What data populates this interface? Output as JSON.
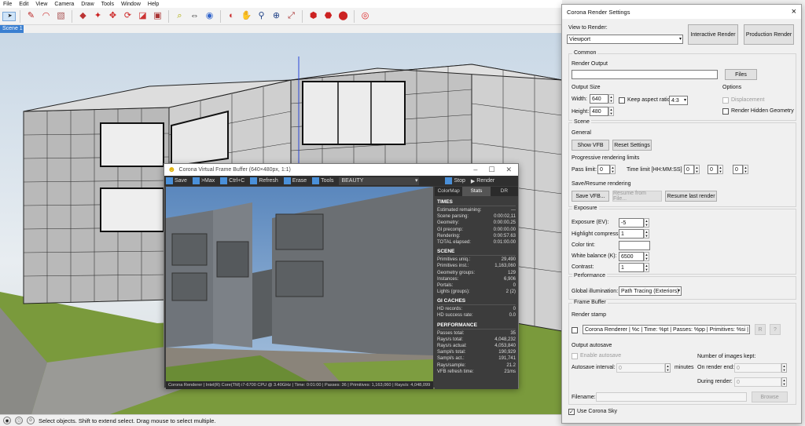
{
  "menu": [
    "File",
    "Edit",
    "View",
    "Camera",
    "Draw",
    "Tools",
    "Window",
    "Help"
  ],
  "scene_tab": "Scene 1",
  "status_text": "Select objects. Shift to extend select. Drag mouse to select multiple.",
  "vfb": {
    "title": "Corona Virtual Frame Buffer (640×480px, 1:1)",
    "toolbar": {
      "save": "Save",
      "max": ">Max",
      "ctrlc": "Ctrl+C",
      "refresh": "Refresh",
      "erase": "Erase",
      "tools": "Tools",
      "pass": "BEAUTY",
      "stop": "Stop",
      "render": "Render"
    },
    "tabs": [
      "ColorMap",
      "Stats",
      "DR"
    ],
    "times": {
      "heading": "TIMES",
      "rows": [
        [
          "Estimated remaining:",
          "---"
        ],
        [
          "Scene parsing:",
          "0:00:02,11"
        ],
        [
          "Geometry:",
          "0:00:00.25"
        ],
        [
          "GI precomp:",
          "0:00:00.00"
        ],
        [
          "Rendering:",
          "0:00:57.63"
        ],
        [
          "TOTAL elapsed:",
          "0:01:00.00"
        ]
      ]
    },
    "scene": {
      "heading": "SCENE",
      "rows": [
        [
          "Primitives uniq.:",
          "29,490"
        ],
        [
          "Primitives inst.:",
          "1,163,060"
        ],
        [
          "Geometry groups:",
          "129"
        ],
        [
          "Instances:",
          "6,906"
        ],
        [
          "Portals:",
          "0"
        ],
        [
          "Lights (groups):",
          "2 (2)"
        ]
      ]
    },
    "gi": {
      "heading": "GI CACHES",
      "rows": [
        [
          "HD records:",
          "0"
        ],
        [
          "HD success rate:",
          "0.0"
        ]
      ]
    },
    "perf": {
      "heading": "PERFORMANCE",
      "rows": [
        [
          "Passes total:",
          "35"
        ],
        [
          "Rays/s total:",
          "4,048,232"
        ],
        [
          "Rays/s actual:",
          "4,053,840"
        ],
        [
          "Sampl/s total:",
          "190,929"
        ],
        [
          "Sampl/s act.:",
          "191,741"
        ],
        [
          "Rays/sample:",
          "21.2"
        ],
        [
          "VFB refresh time:",
          "21ms"
        ]
      ]
    },
    "status": "Corona Renderer | Intel(R) Core(TM) i7-6700 CPU @ 3.40GHz | Time: 0:01:00 | Passes: 36 | Primitives: 1,163,060 | Rays/s: 4,048,099"
  },
  "crs": {
    "title": "Corona Render Settings",
    "close": "×",
    "view_to_render_label": "View to Render:",
    "view_to_render_value": "Viewport",
    "interactive_btn": "Interactive Render",
    "production_btn": "Production Render",
    "common": "Common",
    "render_output": "Render Output",
    "files_btn": "Files",
    "output_size": "Output Size",
    "options": "Options",
    "width_label": "Width:",
    "width_value": "640",
    "height_label": "Height:",
    "height_value": "480",
    "keep_aspect": "Keep aspect ratio",
    "aspect_value": "4:3",
    "displacement": "Displacement",
    "render_hidden": "Render Hidden Geometry",
    "scene": "Scene",
    "general": "General",
    "show_vfb": "Show VFB",
    "reset_settings": "Reset Settings",
    "prog_limits": "Progressive rendering limits",
    "pass_limit_label": "Pass limit:",
    "pass_limit_value": "0",
    "time_limit_label": "Time limit [HH:MM:SS]",
    "time_h": "0",
    "time_m": "0",
    "time_s": "0",
    "save_resume": "Save/Resume rendering",
    "save_vfb": "Save VFB...",
    "resume_file": "Resume from File...",
    "resume_last": "Resume last render",
    "exposure": "Exposure",
    "exposure_ev_label": "Exposure (EV):",
    "exposure_ev": "-5",
    "highlight_label": "Highlight compress:",
    "highlight": "1",
    "color_tint_label": "Color tint:",
    "white_balance_label": "White balance (K):",
    "white_balance": "6500",
    "contrast_label": "Contrast:",
    "contrast": "1",
    "performance": "Performance",
    "gi_label": "Global illumination:",
    "gi_value": "Path Tracing (Exteriors)",
    "frame_buffer": "Frame Buffer",
    "render_stamp": "Render stamp",
    "stamp_text": "Corona Renderer | %c | Time: %pt | Passes: %pp | Primitives: %si | Rays/s: %",
    "stamp_r": "R",
    "stamp_q": "?",
    "output_autosave": "Output autosave",
    "enable_autosave": "Enable autosave",
    "autosave_interval": "Autosave interval:",
    "autosave_value": "0",
    "minutes": "minutes",
    "num_images": "Number of images kept:",
    "on_render_end": "On render end:",
    "on_render_end_value": "0",
    "during_render": "During render:",
    "during_render_value": "0",
    "filename_label": "Filename:",
    "browse": "Browse",
    "use_sky": "Use Corona Sky",
    "use_sky_checked": "✓"
  }
}
